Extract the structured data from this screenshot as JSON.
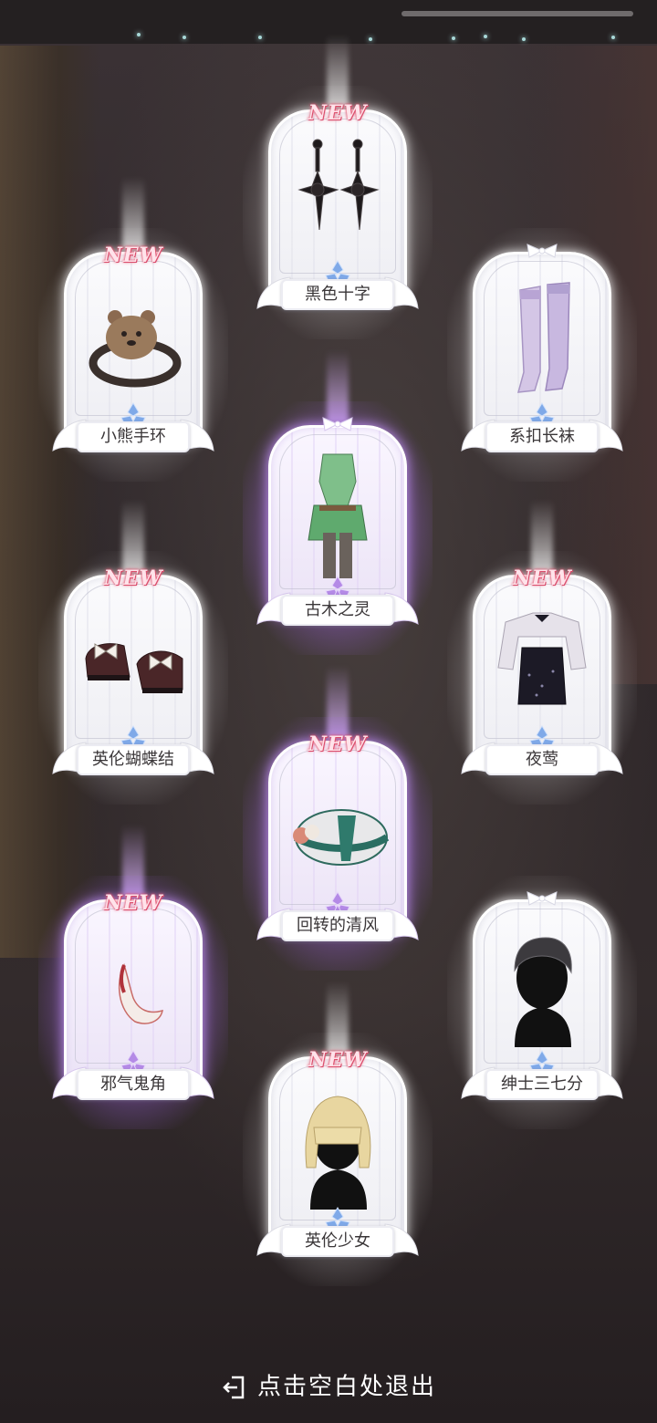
{
  "items": [
    {
      "name": "黑色十字",
      "new": true,
      "rarity": "white",
      "icon": "black-cross-earrings-icon",
      "gem": "blue"
    },
    {
      "name": "小熊手环",
      "new": true,
      "rarity": "white",
      "icon": "bear-bracelet-icon",
      "gem": "blue"
    },
    {
      "name": "系扣长袜",
      "new": false,
      "rarity": "white",
      "icon": "stockings-icon",
      "gem": "blue"
    },
    {
      "name": "古木之灵",
      "new": false,
      "rarity": "purple",
      "icon": "forest-dress-icon",
      "gem": "purple"
    },
    {
      "name": "英伦蝴蝶结",
      "new": true,
      "rarity": "white",
      "icon": "bow-shoes-icon",
      "gem": "blue"
    },
    {
      "name": "夜莺",
      "new": true,
      "rarity": "white",
      "icon": "nightingale-outfit-icon",
      "gem": "blue"
    },
    {
      "name": "回转的清风",
      "new": true,
      "rarity": "purple",
      "icon": "rose-beret-icon",
      "gem": "purple"
    },
    {
      "name": "邪气鬼角",
      "new": true,
      "rarity": "purple",
      "icon": "demon-horn-icon",
      "gem": "purple"
    },
    {
      "name": "绅士三七分",
      "new": false,
      "rarity": "white",
      "icon": "gentleman-hair-icon",
      "gem": "blue"
    },
    {
      "name": "英伦少女",
      "new": true,
      "rarity": "white",
      "icon": "blonde-hair-icon",
      "gem": "blue"
    }
  ],
  "new_badge_text": "NEW",
  "exit_hint": "点击空白处退出",
  "colors": {
    "new_badge": "#e8607a",
    "purple_glow": "#b98cf0",
    "blue_gem": "#7fa9e8",
    "purple_gem": "#b48ae6"
  }
}
